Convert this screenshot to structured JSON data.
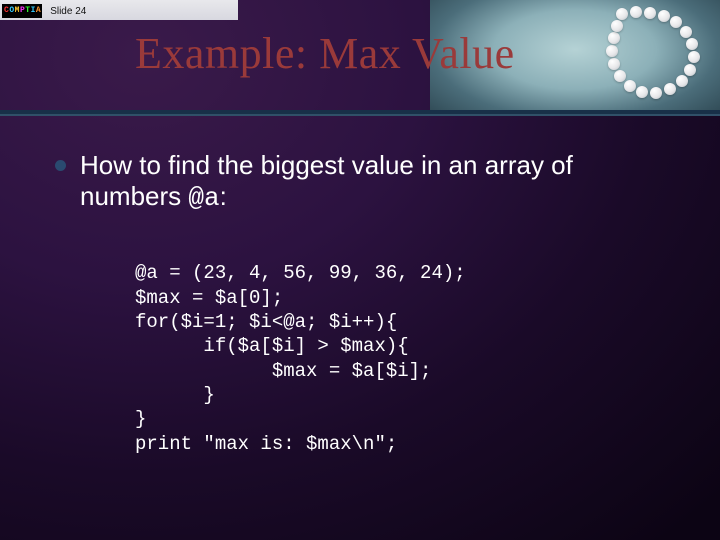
{
  "topbar": {
    "logo_letters": [
      "C",
      "O",
      "M",
      "P",
      "T",
      "I",
      "A"
    ],
    "slide_label": "Slide 24"
  },
  "title": "Example: Max Value",
  "bullet": {
    "text_a": "How to find the biggest value in an array of numbers ",
    "var": "@a",
    "text_b": ":"
  },
  "code": "@a = (23, 4, 56, 99, 36, 24);\n$max = $a[0];\nfor($i=1; $i<@a; $i++){\n      if($a[$i] > $max){\n            $max = $a[$i];\n      }\n}\nprint \"max is: $max\\n\";"
}
